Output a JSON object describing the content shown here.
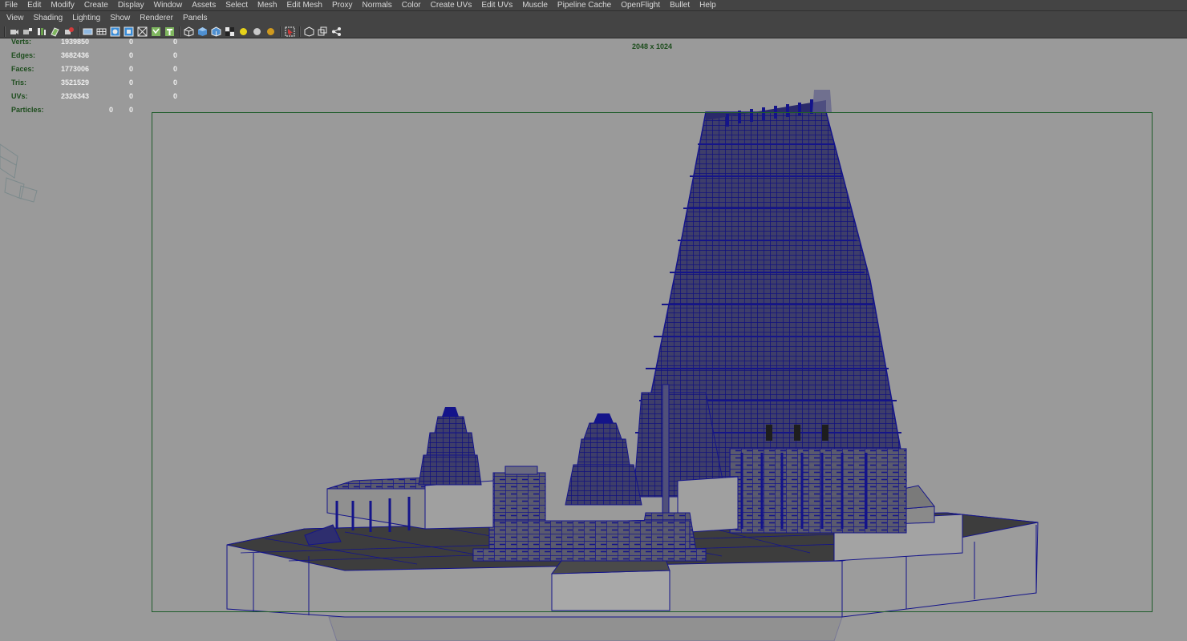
{
  "menubar": {
    "items": [
      "File",
      "Edit",
      "Modify",
      "Create",
      "Display",
      "Window",
      "Assets",
      "Select",
      "Mesh",
      "Edit Mesh",
      "Proxy",
      "Normals",
      "Color",
      "Create UVs",
      "Edit UVs",
      "Muscle",
      "Pipeline Cache",
      "OpenFlight",
      "Bullet",
      "Help"
    ]
  },
  "panel_menu": {
    "items": [
      "View",
      "Shading",
      "Lighting",
      "Show",
      "Renderer",
      "Panels"
    ]
  },
  "toolbar": {
    "icons": [
      "select-camera-icon",
      "camera-attributes-icon",
      "bookmark-icon",
      "image-plane-icon",
      "grease-pencil-icon",
      "2d-pan-zoom-icon",
      "grid-icon",
      "film-gate-icon",
      "resolution-gate-icon",
      "gate-mask-icon",
      "field-chart-icon",
      "safe-action-icon",
      "safe-title-icon",
      "wireframe-icon",
      "smooth-shade-icon",
      "wireframe-on-shaded-icon",
      "textured-icon",
      "use-all-lights-icon",
      "shadows-icon",
      "ambient-occlusion-icon",
      "xray-icon",
      "isolate-select-icon",
      "hud-icon",
      "bounding-box-icon"
    ]
  },
  "hud": {
    "verts": {
      "label": "Verts:",
      "total": "1939850",
      "selected": "0",
      "third": "0"
    },
    "edges": {
      "label": "Edges:",
      "total": "3682436",
      "selected": "0",
      "third": "0"
    },
    "faces": {
      "label": "Faces:",
      "total": "1773006",
      "selected": "0",
      "third": "0"
    },
    "tris": {
      "label": "Tris:",
      "total": "3521529",
      "selected": "0",
      "third": "0"
    },
    "uvs": {
      "label": "UVs:",
      "total": "2326343",
      "selected": "0",
      "third": "0"
    },
    "particles": {
      "label": "Particles:",
      "total": "0",
      "selected": "0"
    }
  },
  "viewport": {
    "resolution_label": "2048 x 1024"
  },
  "colors": {
    "menubar_bg": "#444444",
    "viewport_bg": "#9a9a9a",
    "hud_label": "#1d4d1d",
    "hud_value": "#eeeeee",
    "wireframe": "#14148a",
    "gate_border": "#1e5c2a"
  }
}
